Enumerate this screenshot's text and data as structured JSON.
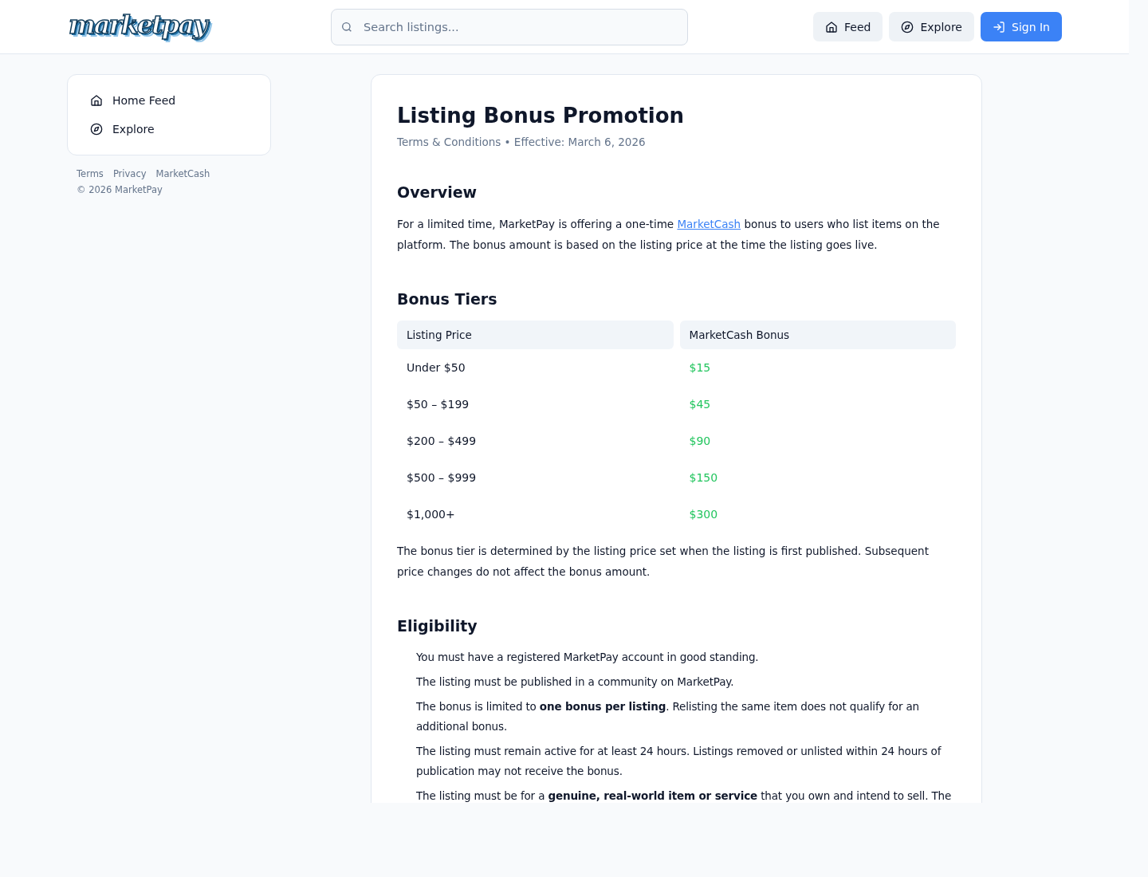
{
  "header": {
    "logo": "marketpay",
    "search": {
      "placeholder": "Search listings..."
    },
    "buttons": [
      {
        "kind": "home",
        "label": "Feed",
        "primary": false
      },
      {
        "kind": "compass",
        "label": "Explore",
        "primary": false
      },
      {
        "kind": "signin",
        "label": "Sign In",
        "primary": true
      }
    ]
  },
  "sidebar": {
    "items": [
      {
        "kind": "home",
        "label": "Home Feed"
      },
      {
        "kind": "compass",
        "label": "Explore"
      }
    ],
    "footer_links": [
      "Terms",
      "Privacy",
      "MarketCash"
    ],
    "copyright": "© 2026 MarketPay"
  },
  "document": {
    "title": "Listing Bonus Promotion",
    "meta": "Terms & Conditions • Effective: March 6, 2026",
    "sections": [
      {
        "kind": "paragraph",
        "heading": "Overview",
        "parts": [
          "For a limited time, MarketPay is offering a one-time ",
          "MarketCash",
          " bonus to users who list items on the platform. The bonus amount is based on the listing price at the time the listing goes live."
        ]
      },
      {
        "kind": "table",
        "heading": "Bonus Tiers",
        "columns": [
          "Listing Price",
          "MarketCash Bonus"
        ],
        "rows": [
          [
            "Under $50",
            "$15"
          ],
          [
            "$50 – $199",
            "$45"
          ],
          [
            "$200 – $499",
            "$90"
          ],
          [
            "$500 – $999",
            "$150"
          ],
          [
            "$1,000+",
            "$300"
          ]
        ],
        "note": "The bonus tier is determined by the listing price set when the listing is first published. Subsequent price changes do not affect the bonus amount."
      },
      {
        "kind": "list",
        "heading": "Eligibility",
        "items": [
          "You must have a registered MarketPay account in good standing.",
          "The listing must be published in a community on MarketPay.",
          "The bonus is limited to **one bonus per listing**. Relisting the same item does not qualify for an additional bonus.",
          "The listing must remain active for at least 24 hours. Listings removed or unlisted within 24 hours of publication may not receive the bonus.",
          "The listing must be for a **genuine, real-world item or service** that you own and intend to sell. The"
        ]
      }
    ]
  }
}
